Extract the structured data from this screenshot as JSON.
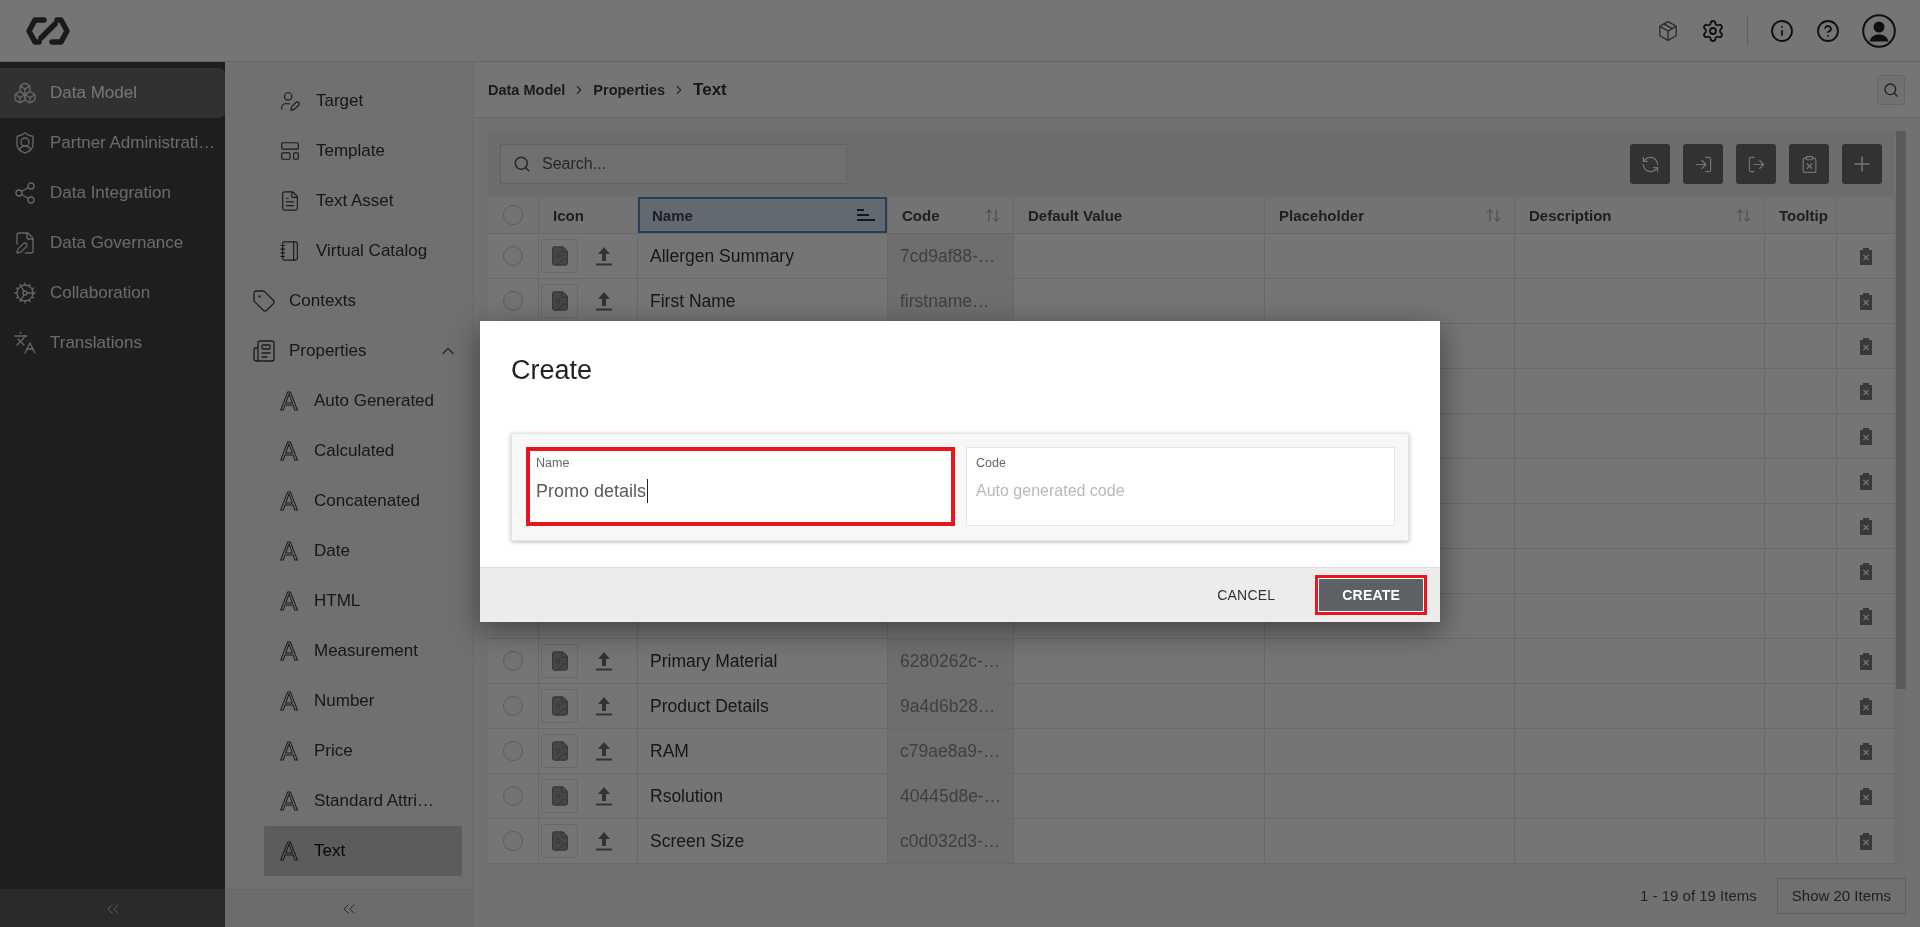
{
  "sidebar": {
    "items": [
      {
        "label": "Data Model",
        "selected": true
      },
      {
        "label": "Partner Administrati…",
        "selected": false
      },
      {
        "label": "Data Integration",
        "selected": false
      },
      {
        "label": "Data Governance",
        "selected": false
      },
      {
        "label": "Collaboration",
        "selected": false
      },
      {
        "label": "Translations",
        "selected": false
      }
    ]
  },
  "subnav": {
    "items": [
      {
        "children": [
          {
            "label": "Target",
            "selected": false
          },
          {
            "label": "Template",
            "selected": false
          },
          {
            "label": "Text Asset",
            "selected": false
          },
          {
            "label": "Virtual Catalog",
            "selected": false
          }
        ]
      },
      {
        "label": "Contexts",
        "selected": false
      },
      {
        "label": "Properties",
        "selected": false,
        "expanded": true,
        "children": [
          {
            "glyph": "A",
            "label": "Auto Generated",
            "selected": false
          },
          {
            "glyph": "A",
            "label": "Calculated",
            "selected": false
          },
          {
            "glyph": "A",
            "label": "Concatenated",
            "selected": false
          },
          {
            "glyph": "A",
            "label": "Date",
            "selected": false
          },
          {
            "glyph": "A",
            "label": "HTML",
            "selected": false
          },
          {
            "glyph": "A",
            "label": "Measurement",
            "selected": false
          },
          {
            "glyph": "A",
            "label": "Number",
            "selected": false
          },
          {
            "glyph": "A",
            "label": "Price",
            "selected": false
          },
          {
            "glyph": "A",
            "label": "Standard Attri…",
            "selected": false
          },
          {
            "glyph": "A",
            "label": "Text",
            "selected": true
          }
        ]
      }
    ]
  },
  "breadcrumb": [
    "Data Model",
    "Properties",
    "Text"
  ],
  "table": {
    "search": {
      "placeholder": "Search..."
    },
    "select_all_checked": false,
    "columns": [
      {
        "label": "Icon",
        "selected": false,
        "sortable": false
      },
      {
        "label": "Name",
        "selected": true,
        "sortable": true,
        "sorted": true
      },
      {
        "label": "Code",
        "selected": false,
        "sortable": true,
        "sorted": false
      },
      {
        "label": "Default Value",
        "selected": false,
        "sortable": false
      },
      {
        "label": "Placeholder",
        "selected": false,
        "sortable": true,
        "sorted": false
      },
      {
        "label": "Description",
        "selected": false,
        "sortable": true,
        "sorted": false
      },
      {
        "label": "Tooltip",
        "selected": false,
        "sortable": false
      }
    ],
    "rows": [
      {
        "kind": "entry",
        "selected": false,
        "name": "Allergen Summary",
        "code": "7cd9af88-…"
      },
      {
        "kind": "entry",
        "selected": false,
        "name": "First Name",
        "code": "firstname…"
      },
      {
        "kind": "blank"
      },
      {
        "kind": "blank"
      },
      {
        "kind": "blank"
      },
      {
        "kind": "blank"
      },
      {
        "kind": "blank"
      },
      {
        "kind": "blank"
      },
      {
        "kind": "blank"
      },
      {
        "kind": "entry",
        "selected": false,
        "name": "Primary Material",
        "code": "6280262c-…"
      },
      {
        "kind": "entry",
        "selected": false,
        "name": "Product Details",
        "code": "9a4d6b28…"
      },
      {
        "kind": "entry",
        "selected": false,
        "name": "RAM",
        "code": "c79ae8a9-…"
      },
      {
        "kind": "entry",
        "selected": false,
        "name": "Rsolution",
        "code": "40445d8e-…"
      },
      {
        "kind": "entry",
        "selected": false,
        "name": "Screen Size",
        "code": "c0d032d3-…"
      }
    ]
  },
  "pagination": {
    "range": "1 - 19 of 19 Items",
    "page_size_button": "Show 20 Items"
  },
  "dialog": {
    "title": "Create",
    "fields": [
      {
        "label": "Name",
        "value": "Promo details",
        "focused": true,
        "highlighted": true
      },
      {
        "label": "Code",
        "placeholder": "Auto generated code",
        "highlighted": false
      }
    ],
    "buttons": [
      {
        "kind": "text",
        "label": "CANCEL",
        "highlighted": false
      },
      {
        "kind": "primary",
        "label": "CREATE",
        "highlighted": true
      }
    ]
  }
}
